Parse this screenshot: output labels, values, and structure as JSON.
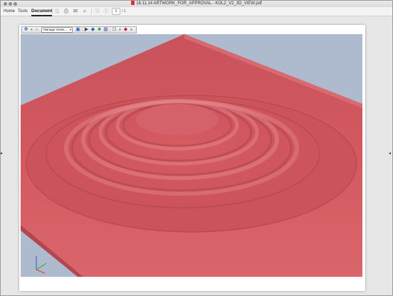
{
  "window": {
    "title": "16.11.14 ARTWORK_FOR_APPROVAL - KOL2_V2_3D_VIEW.pdf",
    "traffic_light_color": "#8c8c8c"
  },
  "toolbar": {
    "tabs": [
      {
        "label": "Home",
        "active": false
      },
      {
        "label": "Tools",
        "active": false
      },
      {
        "label": "Document",
        "active": true
      }
    ],
    "icons": [
      "save-icon",
      "print-icon",
      "mail-icon",
      "search-icon",
      "page-up-icon",
      "page-down-icon"
    ],
    "page_number": "1",
    "page_total": "/ 1"
  },
  "viewer3d": {
    "views_select": "Manage Views...",
    "tools": [
      "rotate-tool-icon",
      "home-view-icon",
      "views-dropdown",
      "fit-icon",
      "lighting-icon",
      "render-mode-icon",
      "background-icon",
      "cross-section-icon",
      "comment-icon"
    ],
    "background_color": "#aebacd",
    "surface_color": "#d3575f",
    "axis_colors": {
      "x": "#e33",
      "y": "#2a2",
      "z": "#35c"
    }
  },
  "document": {
    "page_color": "#ffffff",
    "background_color": "#e7e7e7"
  }
}
